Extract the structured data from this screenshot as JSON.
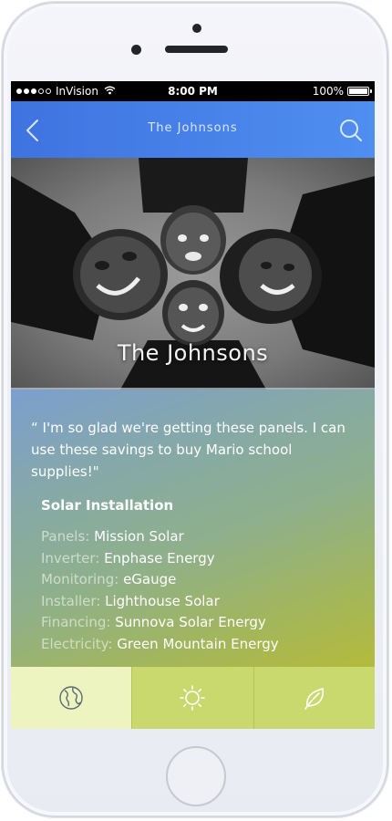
{
  "status_bar": {
    "carrier": "InVision",
    "time": "8:00 PM",
    "battery": "100%"
  },
  "nav": {
    "title": "The Johnsons",
    "back_icon": "chevron-left-icon",
    "search_icon": "search-icon"
  },
  "hero": {
    "title": "The Johnsons"
  },
  "content": {
    "quote": "“ I'm so glad we're getting these panels. I can use these savings to buy Mario school supplies!\"",
    "section_title": "Solar Installation",
    "details": [
      {
        "label": "Panels:",
        "value": "Mission Solar"
      },
      {
        "label": "Inverter:",
        "value": "Enphase Energy"
      },
      {
        "label": "Monitoring:",
        "value": "eGauge"
      },
      {
        "label": "Installer:",
        "value": "Lighthouse Solar"
      },
      {
        "label": "Financing:",
        "value": "Sunnova Solar Energy"
      },
      {
        "label": "Electricity:",
        "value": "Green Mountain Energy"
      }
    ]
  },
  "tabs": [
    {
      "icon": "globe-icon",
      "active": true
    },
    {
      "icon": "sun-icon",
      "active": false
    },
    {
      "icon": "leaf-icon",
      "active": false
    }
  ],
  "colors": {
    "nav_blue": "#4a83ea",
    "tab_active": "#eef4c0",
    "tab_inactive": "#cad96d",
    "icon_stroke": "#5d6a78"
  }
}
